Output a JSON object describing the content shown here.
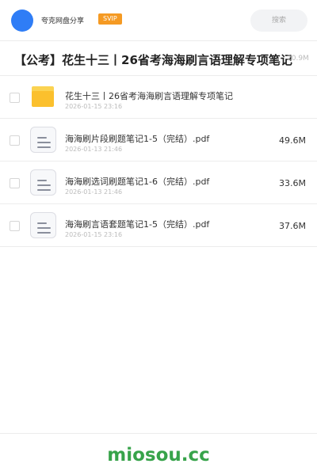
{
  "header": {
    "user_name": "夸克网盘分享",
    "badge": "SVIP",
    "search_placeholder": "搜索"
  },
  "title_row": {
    "title": "【公考】花生十三丨26省考海海刷言语理解专项笔记",
    "total_size": "20.9M"
  },
  "files": [
    {
      "type": "folder",
      "icon": "folder-icon",
      "name": "花生十三丨26省考海海刷言语理解专项笔记",
      "date": "2026-01-15 23:16",
      "size": ""
    },
    {
      "type": "pdf",
      "icon": "document-icon",
      "name": "海海刷片段刷题笔记1-5（完结）.pdf",
      "date": "2026-01-13 21:46",
      "size": "49.6M"
    },
    {
      "type": "pdf",
      "icon": "document-icon",
      "name": "海海刷选词刷题笔记1-6（完结）.pdf",
      "date": "2026-01-13 21:46",
      "size": "33.6M"
    },
    {
      "type": "pdf",
      "icon": "document-icon",
      "name": "海海刷言语套题笔记1-5（完结）.pdf",
      "date": "2026-01-15 23:16",
      "size": "37.6M"
    }
  ],
  "footer": {
    "brand": "miosou.cc"
  },
  "colors": {
    "avatar": "#2f7df6",
    "badge": "#f59a23",
    "folder": "#fbc02d",
    "brand": "#37a34a"
  }
}
